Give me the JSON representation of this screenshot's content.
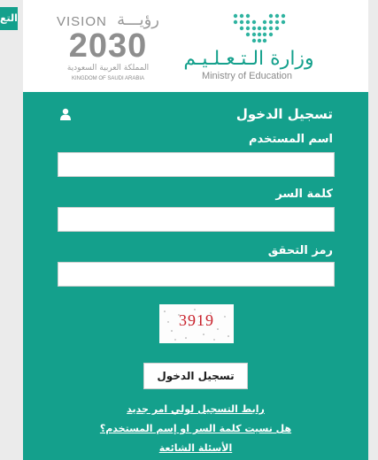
{
  "side_tab": {
    "label": "التع"
  },
  "header": {
    "vision": {
      "word": "VISION",
      "word_ar": "رؤيـــة",
      "year": "2030",
      "kingdom_ar": "المملكة العربية السعودية",
      "kingdom_en": "KINGDOM OF SAUDI ARABIA"
    },
    "ministry": {
      "name_ar": "وزارة الـتـعـلـيـم",
      "name_en": "Ministry of Education"
    }
  },
  "login": {
    "title": "تسجيل الدخول",
    "icon": "user-icon",
    "username_label": "اسم المستخدم",
    "username_value": "",
    "password_label": "كلمة السر",
    "password_value": "",
    "captcha_label": "رمز التحقق",
    "captcha_value": "",
    "captcha_code": "3919",
    "submit_label": "تسجيل الدخول",
    "links": {
      "parent_register": "رابط التسجيل لولي امر جديد",
      "forgot": "هل نسيت كلمة السر او إسم المستخدم؟",
      "faq": "الأسئلة الشائعة"
    }
  },
  "colors": {
    "brand": "#14a08c",
    "captcha_text": "#c8202a",
    "logo_gray": "#8e8e8e"
  }
}
